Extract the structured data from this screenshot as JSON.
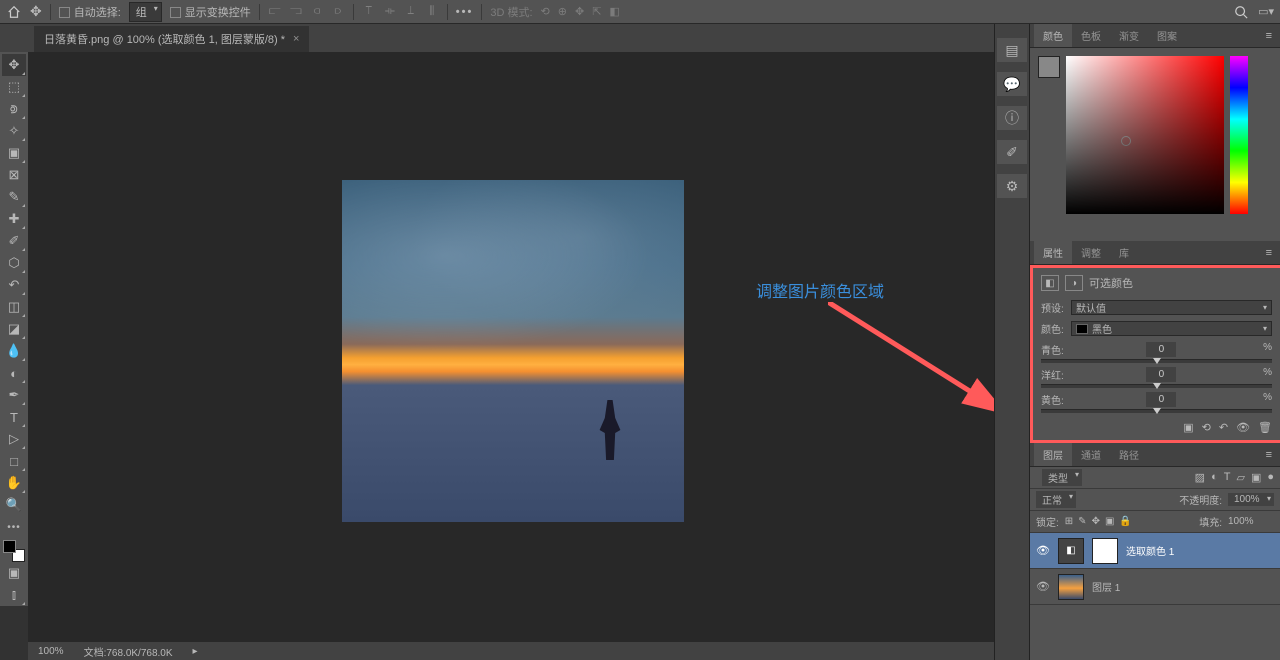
{
  "topbar": {
    "auto_select_label": "自动选择:",
    "select_mode": "组",
    "show_transform": "显示变换控件",
    "mode3d_label": "3D 模式:"
  },
  "doc": {
    "tab_title": "日落黄昏.png @ 100% (选取颜色 1, 图层蒙版/8) *"
  },
  "status": {
    "zoom": "100%",
    "doc_size": "文档:768.0K/768.0K"
  },
  "color_tabs": {
    "colors": "颜色",
    "swatches": "色板",
    "gradients": "渐变",
    "patterns": "图案"
  },
  "props": {
    "tab_props": "属性",
    "tab_adjust": "调整",
    "tab_lib": "库",
    "title": "可选颜色",
    "preset_label": "预设:",
    "preset_value": "默认值",
    "colors_label": "颜色:",
    "colors_value": "黑色",
    "cyan": "青色:",
    "magenta": "洋红:",
    "yellow": "黄色:",
    "cyan_val": "0",
    "magenta_val": "0",
    "yellow_val": "0",
    "pct": "%"
  },
  "layers": {
    "tab_layers": "图层",
    "tab_channels": "通道",
    "tab_paths": "路径",
    "filter_kind": "类型",
    "blend_mode": "正常",
    "opacity_label": "不透明度:",
    "opacity_value": "100%",
    "lock_label": "锁定:",
    "fill_label": "填充:",
    "fill_value": "100%",
    "layer1": "选取颜色 1",
    "layer2": "图层 1"
  },
  "annotation": "调整图片颜色区域",
  "filter_icon": "Q"
}
